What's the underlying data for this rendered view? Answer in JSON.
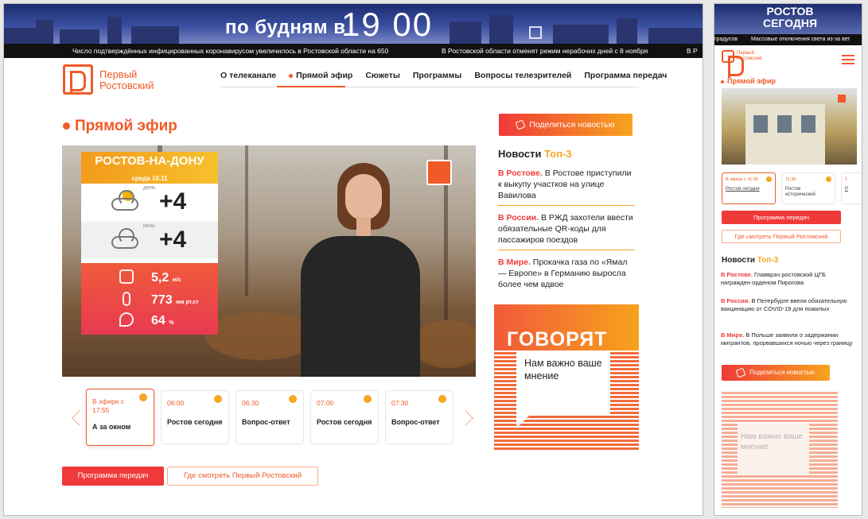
{
  "banner": {
    "text": "по будням в",
    "time": "19 00"
  },
  "ticker": [
    "Число подтверждённых инфицированных коронавирусом увеличилось в Ростовской области на 650",
    "В Ростовской области отменят режим нерабочих дней с 8 ноября",
    "В Р"
  ],
  "logo": {
    "line1": "Первый",
    "line2": "Ростовский"
  },
  "nav": [
    "О телеканале",
    "Прямой эфир",
    "Сюжеты",
    "Программы",
    "Вопросы телезрителей",
    "Программа передач"
  ],
  "live_title": "Прямой эфир",
  "weather": {
    "city": "РОСТОВ-НА-ДОНУ",
    "date": "среда 10.11",
    "day_label": "день",
    "day_temp": "+4",
    "night_label": "ночь",
    "night_temp": "+4",
    "wind": "5,2",
    "wind_unit": "м/с",
    "pressure": "773",
    "pressure_unit": "мм рт.ст",
    "humidity": "64",
    "humidity_unit": "%"
  },
  "schedule": [
    {
      "time": "В эфире с 17:55",
      "name": "А за окном"
    },
    {
      "time": "06:00",
      "name": "Ростов сегодня"
    },
    {
      "time": "06:30",
      "name": "Вопрос-ответ"
    },
    {
      "time": "07:00",
      "name": "Ростов сегодня"
    },
    {
      "time": "07:30",
      "name": "Вопрос-ответ"
    }
  ],
  "buttons": {
    "schedule": "Программа передач",
    "where": "Где смотреть Первый Ростовский",
    "share": "Поделиться новостью"
  },
  "news_title": {
    "prefix": "Новости",
    "accent": "Топ-3"
  },
  "news": [
    {
      "tag": "В Ростове.",
      "text": "В Ростове приступили к выкупу участков на улице Вавилова"
    },
    {
      "tag": "В России.",
      "text": "В РЖД захотели ввести обязательные QR-коды для пассажиров поездов"
    },
    {
      "tag": "В Мире.",
      "text": "Прокачка газа по «Ямал — Европе» в Германию выросла более чем вдвое"
    }
  ],
  "govoryat": {
    "title": "ГОВОРЯТ",
    "sub": "Нам важно ваше мнение"
  },
  "mobile": {
    "banner": "РОСТОВ СЕГОДНЯ",
    "ticker": [
      "градусов",
      "Массовые отключения света из-за вет"
    ],
    "live_title": "Прямой эфир",
    "schedule": [
      {
        "time": "В эфире с 11:00",
        "name": "Ростов сегодня"
      },
      {
        "time": "11:30",
        "name": "Ростов исторический"
      },
      {
        "time": "1",
        "name": "Р"
      }
    ],
    "btn_schedule": "Программа передач",
    "btn_where": "Где смотреть Первый Ростовский",
    "news": [
      {
        "tag": "В Ростове.",
        "text": "Главврач ростовской ЦГБ награжден орденом Пирогова"
      },
      {
        "tag": "В России.",
        "text": "В Петербурге ввели обязательную вакцинацию от COVID-19 для пожилых"
      },
      {
        "tag": "В Мире.",
        "text": "В Польше заявили о задержании мигрантов, прорвавшихся ночью через границу"
      }
    ],
    "share": "Поделиться новостью",
    "gov_sub": "Нам важно ваше мнение"
  }
}
